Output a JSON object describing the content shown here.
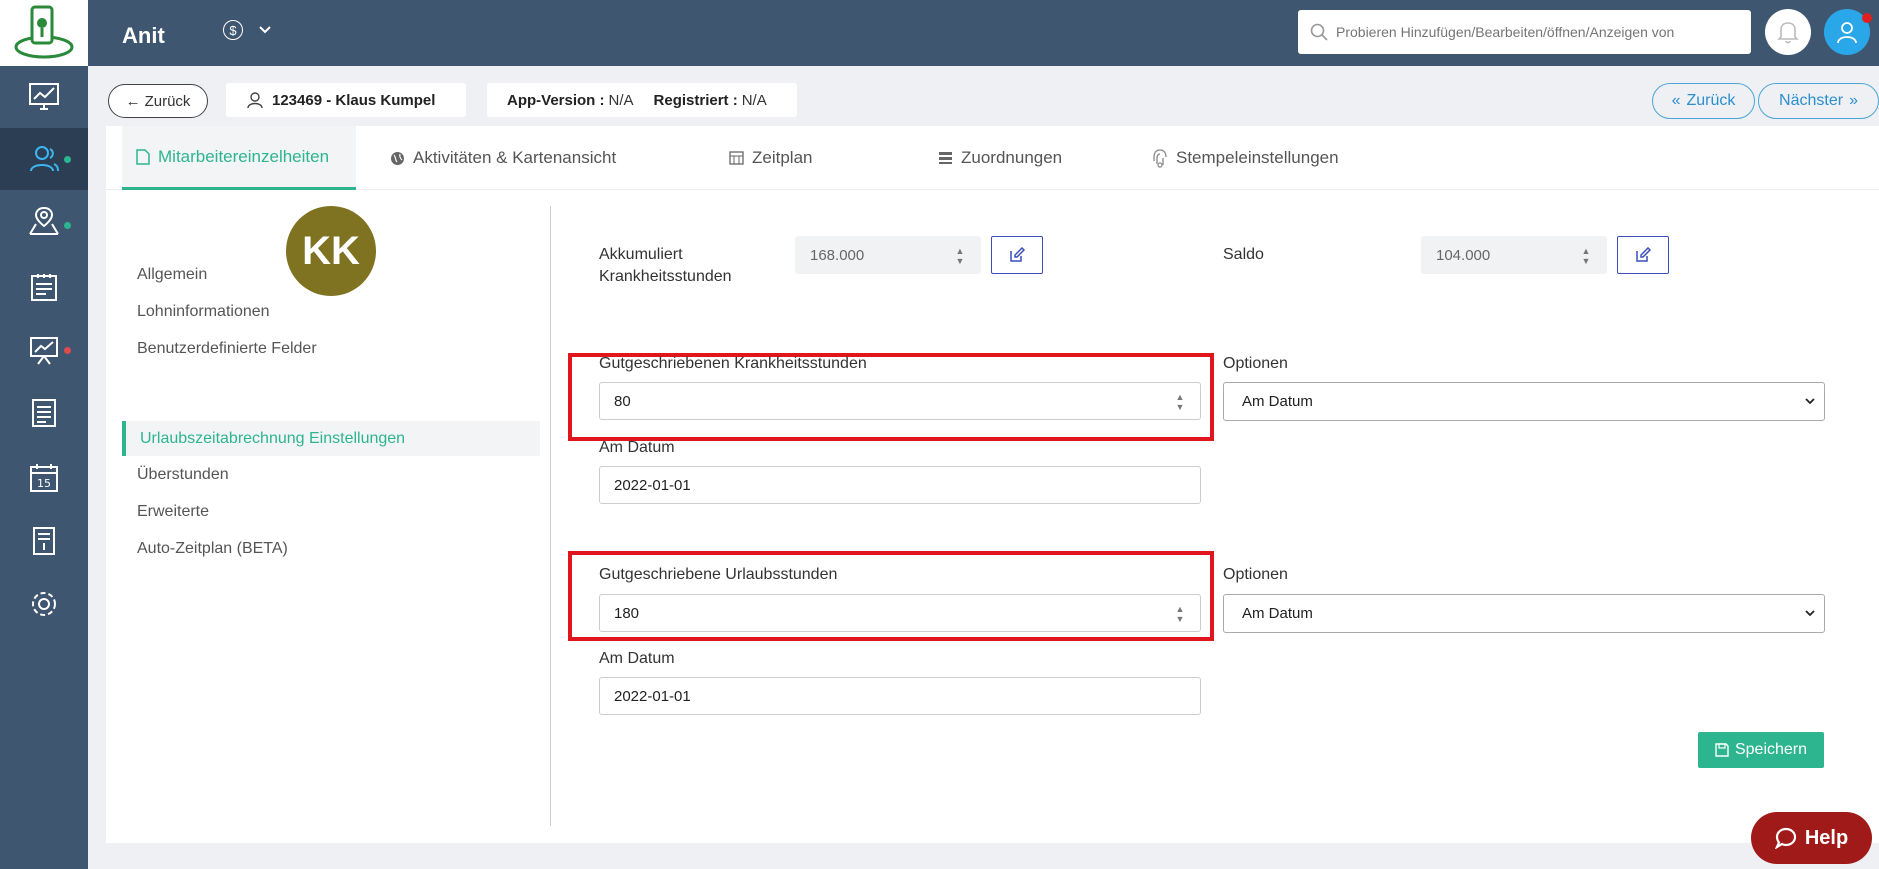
{
  "topbar": {
    "app_title": "Anit",
    "currency_symbol": "$",
    "search_placeholder": "Probieren Hinzufügen/Bearbeiten/öffnen/Anzeigen von"
  },
  "header": {
    "back_label": "Zurück",
    "employee_label": "123469 - Klaus Kumpel",
    "app_version_label": "App-Version :",
    "app_version_value": "N/A",
    "registered_label": "Registriert :",
    "registered_value": "N/A",
    "prev_label": "Zurück",
    "next_label": "Nächster"
  },
  "tabs": [
    {
      "label": "Mitarbeitereinzelheiten",
      "icon": "file-icon"
    },
    {
      "label": "Aktivitäten & Kartenansicht",
      "icon": "globe-icon"
    },
    {
      "label": "Zeitplan",
      "icon": "calendar-icon"
    },
    {
      "label": "Zuordnungen",
      "icon": "server-icon"
    },
    {
      "label": "Stempeleinstellungen",
      "icon": "fingerprint-icon"
    }
  ],
  "profile": {
    "initials": "KK"
  },
  "side_menu": [
    "Allgemein",
    "Lohninformationen",
    "Benutzerdefinierte Felder",
    "Urlaubszeitabrechnung Einstellungen",
    "Überstunden",
    "Erweiterte",
    "Auto-Zeitplan (BETA)"
  ],
  "form": {
    "accumulated_label_1": "Akkumuliert",
    "accumulated_label_2": "Krankheitsstunden",
    "accumulated_value": "168.000",
    "balance_label": "Saldo",
    "balance_value": "104.000",
    "sick_credit_label": "Gutgeschriebenen Krankheitsstunden",
    "sick_credit_value": "80",
    "options_label": "Optionen",
    "option_selected": "Am Datum",
    "date_label": "Am Datum",
    "sick_date_value": "2022-01-01",
    "vacation_credit_label": "Gutgeschriebene Urlaubsstunden",
    "vacation_credit_value": "180",
    "vacation_date_value": "2022-01-01",
    "save_label": "Speichern"
  },
  "help_label": "Help",
  "colors": {
    "accent": "#2db58f",
    "sidebar": "#3f5670",
    "highlight": "#e0161c",
    "help": "#a11a1a"
  }
}
